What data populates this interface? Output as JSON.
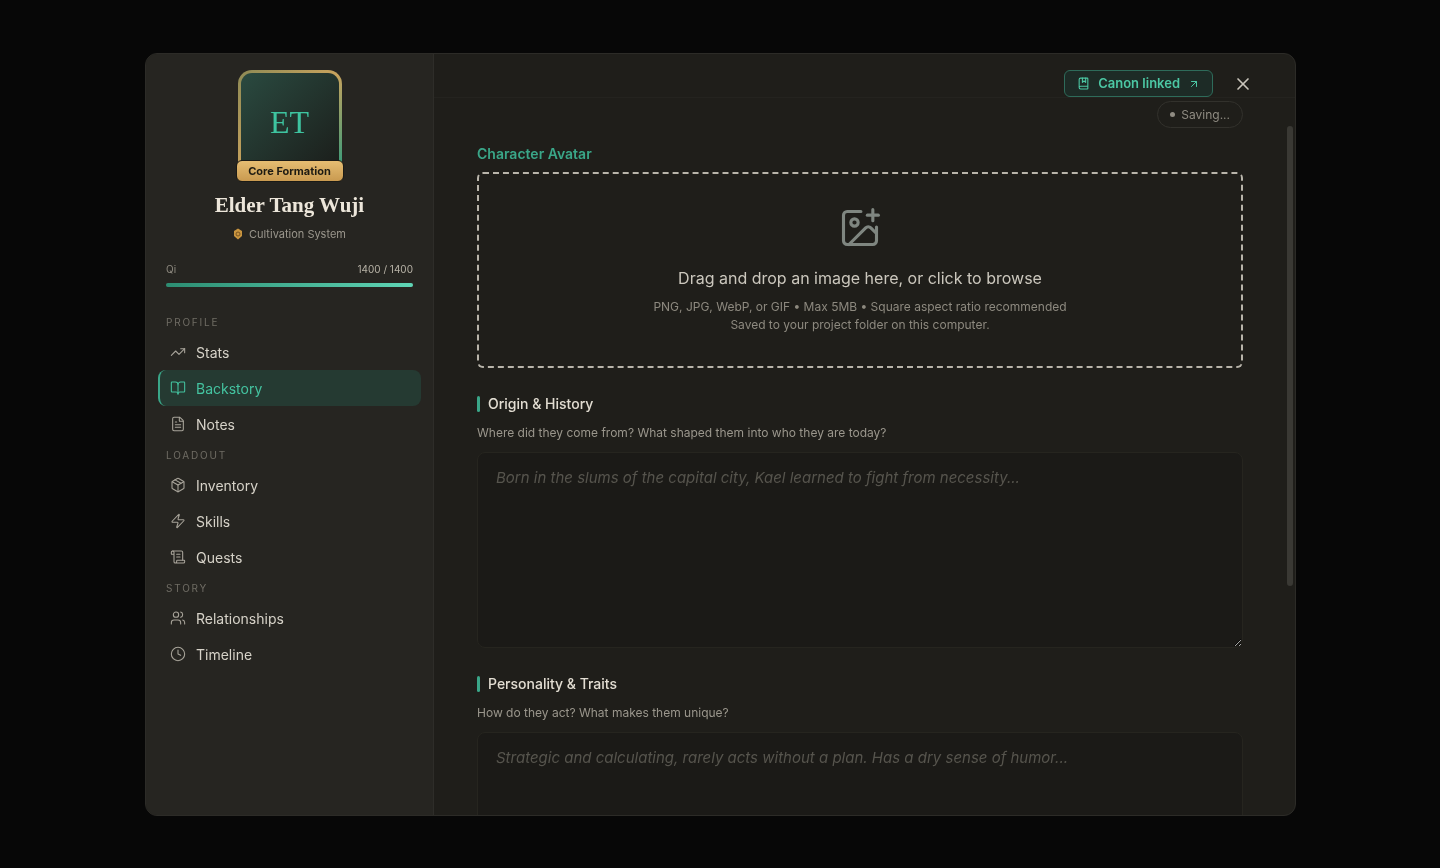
{
  "character": {
    "initials": "ET",
    "rank": "Core Formation",
    "name": "Elder Tang Wuji",
    "system": "Cultivation System"
  },
  "resource": {
    "label": "Qi",
    "reading": "1400 / 1400",
    "level": 1
  },
  "nav": [
    {
      "heading": "PROFILE",
      "items": [
        {
          "label": "Stats",
          "selected": false
        },
        {
          "label": "Backstory",
          "selected": true
        },
        {
          "label": "Notes",
          "selected": false
        }
      ]
    },
    {
      "heading": "LOADOUT",
      "items": [
        {
          "label": "Inventory",
          "selected": false
        },
        {
          "label": "Skills",
          "selected": false
        },
        {
          "label": "Quests",
          "selected": false
        }
      ]
    },
    {
      "heading": "STORY",
      "items": [
        {
          "label": "Relationships",
          "selected": false
        },
        {
          "label": "Timeline",
          "selected": false
        }
      ]
    }
  ],
  "canon_button": "Canon linked",
  "save_status": "Saving...",
  "avatar": {
    "heading": "Character Avatar",
    "prompt": "Drag and drop an image here, or click to browse",
    "hint": "PNG, JPG, WebP, or GIF • Max 5MB • Square aspect ratio recommended",
    "note": "Saved to your project folder on this computer."
  },
  "sections": [
    {
      "title": "Origin & History",
      "help": "Where did they come from? What shaped them into who they are today?",
      "placeholder": "Born in the slums of the capital city, Kael learned to fight from necessity..."
    },
    {
      "title": "Personality & Traits",
      "help": "How do they act? What makes them unique?",
      "placeholder": "Strategic and calculating, rarely acts without a plan. Has a dry sense of humor..."
    }
  ]
}
